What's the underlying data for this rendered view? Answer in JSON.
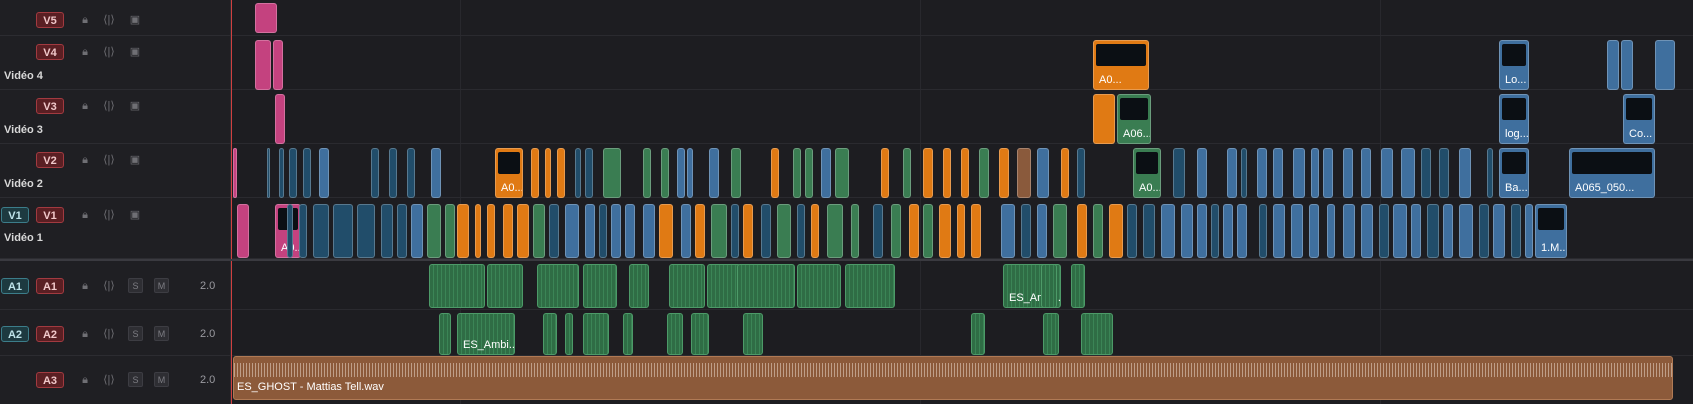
{
  "colors": {
    "video_clip": "#3f6f9e",
    "orange_clip": "#e07a14",
    "pink_clip": "#c4427f",
    "audio_clip": "#3a7d52",
    "music_clip": "#8c5a3a",
    "playhead": "#d04040"
  },
  "tracks": {
    "v5": {
      "badge": "V5"
    },
    "v4": {
      "badge": "V4",
      "name": "Vidéo 4"
    },
    "v3": {
      "badge": "V3",
      "name": "Vidéo 3"
    },
    "v2": {
      "badge": "V2",
      "name": "Vidéo 2"
    },
    "v1": {
      "badge": "V1",
      "patch": "V1",
      "name": "Vidéo 1"
    },
    "a1": {
      "badge": "A1",
      "patch": "A1",
      "solo": "S",
      "mute": "M",
      "volume": "2.0"
    },
    "a2": {
      "badge": "A2",
      "patch": "A2",
      "solo": "S",
      "mute": "M",
      "volume": "2.0"
    },
    "a3": {
      "badge": "A3",
      "solo": "S",
      "mute": "M",
      "volume": "2.0"
    }
  },
  "icons": {
    "lock": "lock-icon",
    "link": "link-icon",
    "film": "film-icon"
  },
  "clips": {
    "v4_orange": "A0...",
    "v4_lo": "Lo...",
    "v3_a06": "A06...",
    "v3_log": "log...",
    "v3_co": "Co...",
    "v2_orange": "A0...",
    "v2_a0": "A0...",
    "v2_ba": "Ba...",
    "v2_a065": "A065_050...",
    "v1_pink": "A0...",
    "v1_1m": "1.M...",
    "a1_ambi": "ES_Ambi...",
    "a2_ambi": "ES_Ambi...",
    "music": "ES_GHOST - Mattias Tell.wav"
  }
}
